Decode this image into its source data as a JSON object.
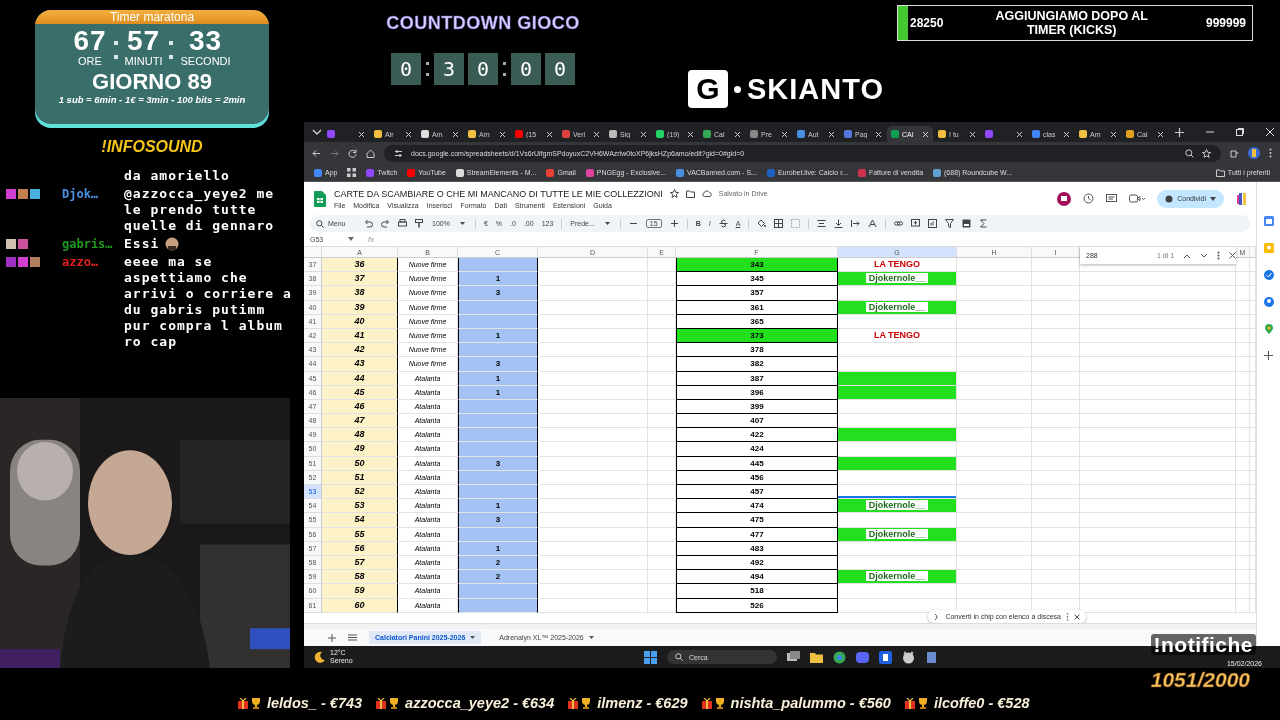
{
  "timer": {
    "title": "Timer maratona",
    "hours": "67",
    "minutes": "57",
    "seconds": "33",
    "hours_label": "ORE",
    "minutes_label": "MINUTI",
    "seconds_label": "SECONDI",
    "day": "GIORNO 89",
    "rates": "1 sub = 6min - 1€ = 3min - 100 bits = 2min"
  },
  "infosound": "!INFOSOUND",
  "chat": [
    {
      "text": "da amoriello"
    },
    {
      "user": "Djok…",
      "color": "#4a90e2",
      "badges": [
        {
          "color": "#d040d0"
        },
        {
          "color": "#c08050"
        },
        {
          "color": "#4ab0e0"
        }
      ],
      "text": "@azzocca_yeye2 me le prendo tutte quelle di gennaro"
    },
    {
      "user": "gabris…",
      "color": "#1f9a1f",
      "badges": [
        {
          "color": "#d0c0b0"
        },
        {
          "color": "#d050a0"
        }
      ],
      "text": "Essi",
      "emote": true
    },
    {
      "user": "azzo…",
      "color": "#e02020",
      "badges": [
        {
          "color": "#a030c0"
        },
        {
          "color": "#d040d0"
        },
        {
          "color": "#b08060"
        }
      ],
      "text": "eeee ma se aspettiamo che arrivi o corriere a du gabris putimm pur compra l album ro cap"
    }
  ],
  "countdown": {
    "title": "COUNTDOWN GIOCO",
    "groups": [
      [
        "0"
      ],
      [
        "3",
        "0"
      ],
      [
        "0",
        "0"
      ]
    ]
  },
  "logo": {
    "mark": "G",
    "text": "SKIANTO"
  },
  "kicks": {
    "current": "28250",
    "title": "AGGIUNGIAMO DOPO AL TIMER (KICKS)",
    "target": "999999",
    "level": 0.028
  },
  "browser": {
    "tabs": [
      {
        "color": "#9146ff",
        "selected": false
      },
      {
        "label": "Air",
        "color": "#f0c040",
        "selected": false
      },
      {
        "label": "Am",
        "color": "#dddddd",
        "selected": false
      },
      {
        "label": "Am",
        "color": "#f0c040",
        "selected": false
      },
      {
        "label": "(15",
        "color": "#ff0000",
        "selected": false
      },
      {
        "label": "Veri",
        "color": "#e04040",
        "selected": false
      },
      {
        "label": "Sig",
        "color": "#bbbbbb",
        "selected": false
      },
      {
        "label": "(19)",
        "color": "#25d366",
        "selected": false
      },
      {
        "label": "Cal",
        "color": "#34a853",
        "selected": false
      },
      {
        "label": "Pre",
        "color": "#888888",
        "selected": false
      },
      {
        "label": "Aut",
        "color": "#4a90e2",
        "selected": false
      },
      {
        "label": "Pag",
        "color": "#5577dd",
        "selected": false
      },
      {
        "label": "CAI",
        "color": "#0f9d58",
        "selected": true
      },
      {
        "label": "I tu",
        "color": "#f0c040",
        "selected": false
      },
      {
        "color": "#9146ff",
        "selected": false
      },
      {
        "label": "clas",
        "color": "#4285f4",
        "selected": false
      },
      {
        "label": "Am",
        "color": "#f0c040",
        "selected": false
      },
      {
        "label": "Cal",
        "color": "#e0a020",
        "selected": false
      }
    ],
    "url": "docs.google.com/spreadsheets/d/1Vs6rUifgmSPdoyuxC2VH6WAzrlw0toXP6jksHZp6amo/edit?gid=0#gid=0",
    "bookmarks": [
      {
        "label": "App",
        "color": "#4285f4"
      },
      {
        "label": "Twitch",
        "color": "#9146ff"
      },
      {
        "label": "YouTube",
        "color": "#ff0000"
      },
      {
        "label": "StreamElements - M...",
        "color": "#dddddd"
      },
      {
        "label": "Gmail",
        "color": "#ea4335"
      },
      {
        "label": "PNGEgg - Exclusive...",
        "color": "#e040a0"
      },
      {
        "label": "VACBanned.com - S...",
        "color": "#4a90e2"
      },
      {
        "label": "Eurobet.live: Calcio r...",
        "color": "#2060c0"
      },
      {
        "label": "Fatture di vendita",
        "color": "#d03050"
      },
      {
        "label": "(688) Roundcube W...",
        "color": "#60a0d0"
      }
    ],
    "all_bookmarks": "Tutti i preferiti"
  },
  "sheets": {
    "title": "CARTE DA SCAMBIARE O CHE MI MANCANO DI TUTTE LE MIE COLLEZZIONI",
    "saved": "Salvato in Drive",
    "share": "Condividi",
    "menu": [
      "File",
      "Modifica",
      "Visualizza",
      "Inserisci",
      "Formato",
      "Dati",
      "Strumenti",
      "Estensioni",
      "Guida"
    ],
    "toolbar": {
      "search": "Menu",
      "zoom": "100%",
      "currency": "€",
      "percent": "%",
      "dec_less": ".0",
      "dec_more": ".00",
      "format": "123",
      "font": "Prede...",
      "size": "15",
      "bold": "B",
      "italic": "I",
      "text_color": "A"
    },
    "cell_ref": "G53",
    "fx": "fx",
    "columns": [
      "A",
      "B",
      "C",
      "D",
      "E",
      "F",
      "G",
      "H",
      "I",
      "M"
    ],
    "find": {
      "value": "288",
      "count": "1 di 1"
    },
    "rows": [
      {
        "num": "37",
        "a": "36",
        "b": "Nuove firme",
        "f": "343",
        "f_fill": true,
        "g": {
          "text": "LA TENGO",
          "color": "#cc0000"
        },
        "g_fill": false,
        "selected": false
      },
      {
        "num": "38",
        "a": "37",
        "b": "Nuove firme",
        "c": "1",
        "f": "345",
        "f_fill": false,
        "g": {
          "text": "Djokernole__",
          "color": "#1e6b1e"
        },
        "g_fill": true,
        "selected": false
      },
      {
        "num": "39",
        "a": "38",
        "b": "Nuove firme",
        "c": "3",
        "f": "357",
        "f_fill": false,
        "g_fill": false,
        "selected": false
      },
      {
        "num": "40",
        "a": "39",
        "b": "Nuove firme",
        "f": "361",
        "f_fill": false,
        "g": {
          "text": "Djokernole__",
          "color": "#1e6b1e"
        },
        "g_fill": true,
        "selected": false
      },
      {
        "num": "41",
        "a": "40",
        "b": "Nuove firme",
        "f": "365",
        "f_fill": false,
        "g_fill": false,
        "selected": false
      },
      {
        "num": "42",
        "a": "41",
        "b": "Nuove firme",
        "c": "1",
        "f": "373",
        "f_fill": true,
        "g": {
          "text": "LA TENGO",
          "color": "#cc0000"
        },
        "g_fill": false,
        "selected": false
      },
      {
        "num": "43",
        "a": "42",
        "b": "Nuove firme",
        "f": "378",
        "f_fill": false,
        "g_fill": false,
        "selected": false
      },
      {
        "num": "44",
        "a": "43",
        "b": "Nuove firme",
        "c": "3",
        "f": "382",
        "f_fill": false,
        "g_fill": false,
        "selected": false
      },
      {
        "num": "45",
        "a": "44",
        "b": "Atalanta",
        "c": "1",
        "f": "387",
        "f_fill": false,
        "g_fill": true,
        "selected": false
      },
      {
        "num": "46",
        "a": "45",
        "b": "Atalanta",
        "c": "1",
        "f": "396",
        "f_fill": false,
        "g_fill": true,
        "selected": false
      },
      {
        "num": "47",
        "a": "46",
        "b": "Atalanta",
        "f": "399",
        "f_fill": false,
        "g_fill": false,
        "selected": false
      },
      {
        "num": "48",
        "a": "47",
        "b": "Atalanta",
        "f": "407",
        "f_fill": false,
        "g_fill": false,
        "selected": false
      },
      {
        "num": "49",
        "a": "48",
        "b": "Atalanta",
        "f": "422",
        "f_fill": false,
        "g_fill": true,
        "selected": false
      },
      {
        "num": "50",
        "a": "49",
        "b": "Atalanta",
        "f": "424",
        "f_fill": false,
        "g_fill": false,
        "selected": false
      },
      {
        "num": "51",
        "a": "50",
        "b": "Atalanta",
        "c": "3",
        "f": "445",
        "f_fill": false,
        "g_fill": true,
        "selected": false
      },
      {
        "num": "52",
        "a": "51",
        "b": "Atalanta",
        "f": "456",
        "f_fill": false,
        "g_fill": false,
        "selected": false
      },
      {
        "num": "53",
        "a": "52",
        "b": "Atalanta",
        "f": "457",
        "f_fill": false,
        "g_fill": false,
        "selected": true
      },
      {
        "num": "54",
        "a": "53",
        "b": "Atalanta",
        "c": "1",
        "f": "474",
        "f_fill": false,
        "g": {
          "text": "Djokernole__",
          "color": "#1e6b1e"
        },
        "g_fill": true,
        "selected": false
      },
      {
        "num": "55",
        "a": "54",
        "b": "Atalanta",
        "c": "3",
        "f": "475",
        "f_fill": false,
        "g_fill": false,
        "selected": false
      },
      {
        "num": "56",
        "a": "55",
        "b": "Atalanta",
        "f": "477",
        "f_fill": false,
        "g": {
          "text": "Djokernole__",
          "color": "#1e6b1e"
        },
        "g_fill": true,
        "selected": false
      },
      {
        "num": "57",
        "a": "56",
        "b": "Atalanta",
        "c": "1",
        "f": "483",
        "f_fill": false,
        "g_fill": false,
        "selected": false
      },
      {
        "num": "58",
        "a": "57",
        "b": "Atalanta",
        "c": "2",
        "f": "492",
        "f_fill": false,
        "g_fill": false,
        "selected": false
      },
      {
        "num": "59",
        "a": "58",
        "b": "Atalanta",
        "c": "2",
        "f": "494",
        "f_fill": false,
        "g": {
          "text": "Djokernole__",
          "color": "#1e6b1e"
        },
        "g_fill": true,
        "selected": false
      },
      {
        "num": "60",
        "a": "59",
        "b": "Atalanta",
        "f": "518",
        "f_fill": false,
        "g_fill": false,
        "selected": false
      },
      {
        "num": "61",
        "a": "60",
        "b": "Atalanta",
        "f": "526",
        "f_fill": false,
        "g_fill": false,
        "selected": false
      }
    ],
    "chip_toast": "Converti in chip con elenco a discesa",
    "sheet_tabs": [
      {
        "label": "Calciatori Panini 2025-2026",
        "selected": true
      },
      {
        "label": "Adrenalyn XL™ 2025-2026",
        "selected": false
      }
    ]
  },
  "taskbar": {
    "temperature": "12°C",
    "weather": "Sereno",
    "search": "Cerca",
    "date": "15/02/2026"
  },
  "notifications": "!notifiche",
  "goal": "1051/2000",
  "ticker": [
    "leldos_ - €743",
    "azzocca_yeye2 - €634",
    "ilmenz - €629",
    "nishta_palummo - €560",
    "ilcoffe0 - €528"
  ]
}
